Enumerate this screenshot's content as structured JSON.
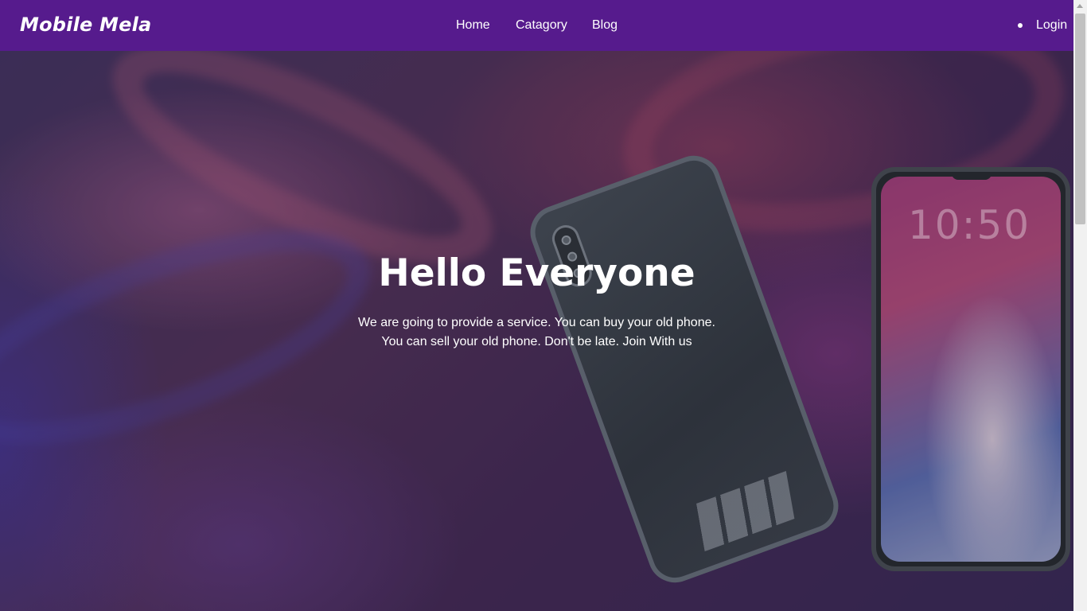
{
  "navbar": {
    "brand": "Mobile Mela",
    "links": [
      "Home",
      "Catagory",
      "Blog"
    ],
    "login_label": "Login"
  },
  "hero": {
    "title": "Hello Everyone",
    "line1": "We are going to provide a service. You can buy your old phone.",
    "line2": "You can sell your old phone. Don't be late. Join With us",
    "phone_time": "10:50"
  },
  "colors": {
    "navbar_bg": "#561b8d",
    "text": "#ffffff"
  }
}
